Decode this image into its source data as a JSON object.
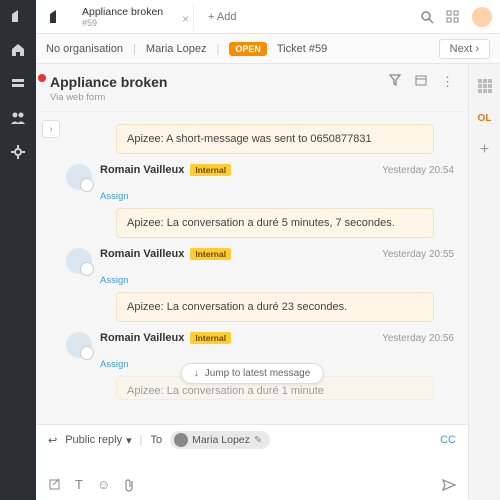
{
  "tab": {
    "title": "Appliance broken",
    "subtitle": "#59",
    "add": "+ Add"
  },
  "crumbs": {
    "org": "No organisation",
    "user": "Maria Lopez",
    "open": "OPEN",
    "ticket": "Ticket #59",
    "next": "Next"
  },
  "ticket": {
    "title": "Appliance broken",
    "via": "Via web form"
  },
  "jump": "Jump to latest message",
  "messages": [
    {
      "kind": "note",
      "body": "Apizee: A short-message was sent to 0650877831"
    },
    {
      "kind": "msg",
      "author": "Romain Vailleux",
      "tag": "Internal",
      "assign": "Assign",
      "time": "Yesterday 20:54",
      "body": "Apizee: La conversation a duré 5 minutes, 7 secondes."
    },
    {
      "kind": "msg",
      "author": "Romain Vailleux",
      "tag": "Internal",
      "assign": "Assign",
      "time": "Yesterday 20:55",
      "body": "Apizee: La conversation a duré 23 secondes."
    },
    {
      "kind": "msg",
      "author": "Romain Vailleux",
      "tag": "Internal",
      "assign": "Assign",
      "time": "Yesterday 20:56",
      "body": "Apizee: La conversation a duré 1 minute"
    }
  ],
  "compose": {
    "type": "Public reply",
    "toLabel": "To",
    "to": "Maria Lopez",
    "cc": "CC"
  }
}
